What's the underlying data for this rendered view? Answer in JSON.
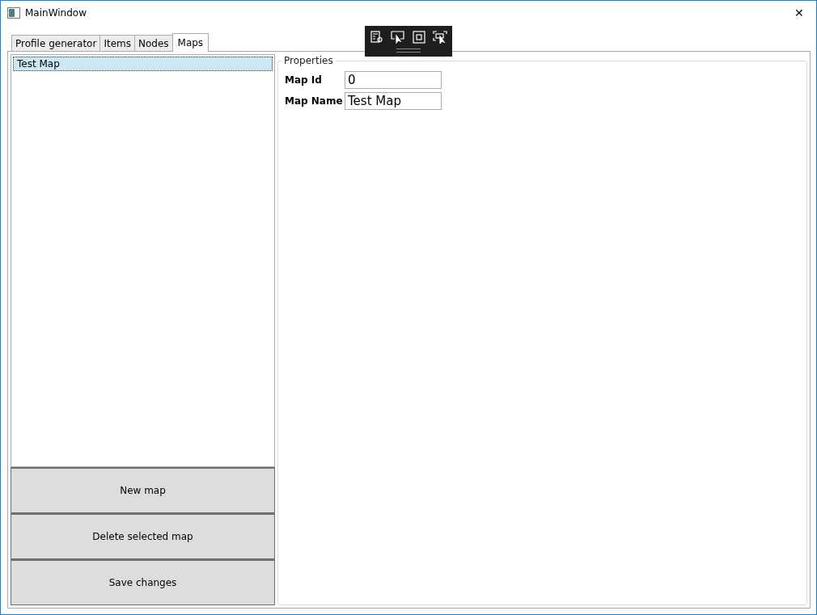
{
  "window": {
    "title": "MainWindow",
    "close": "✕"
  },
  "tabs": [
    {
      "label": "Profile generator",
      "selected": false
    },
    {
      "label": "Items",
      "selected": false
    },
    {
      "label": "Nodes",
      "selected": false
    },
    {
      "label": "Maps",
      "selected": true
    }
  ],
  "maps_list": [
    {
      "label": "Test Map",
      "selected": true
    }
  ],
  "buttons": [
    "New map",
    "Delete selected map",
    "Save changes"
  ],
  "properties": {
    "title": "Properties",
    "fields": [
      {
        "label": "Map Id",
        "value": "0"
      },
      {
        "label": "Map Name",
        "value": "Test Map"
      }
    ]
  }
}
